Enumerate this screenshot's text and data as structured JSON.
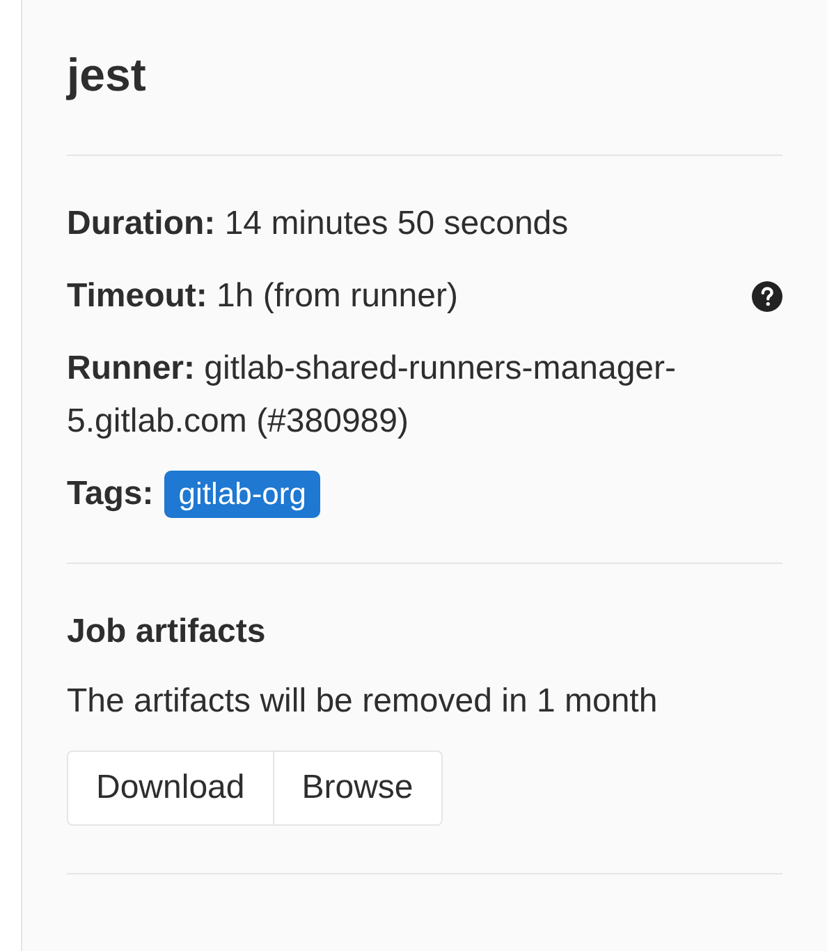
{
  "title": "jest",
  "details": [
    {
      "kind": "text",
      "label": "Duration:",
      "value": "14 minutes 50 seconds",
      "help": false
    },
    {
      "kind": "text",
      "label": "Timeout:",
      "value": "1h (from runner)",
      "help": true
    },
    {
      "kind": "text",
      "label": "Runner:",
      "value": "gitlab-shared-runners-manager-5.gitlab.com (#380989)",
      "help": false
    },
    {
      "kind": "tags",
      "label": "Tags:",
      "tags": [
        "gitlab-org"
      ],
      "help": false
    }
  ],
  "artifacts": {
    "title": "Job artifacts",
    "message": "The artifacts will be removed in 1 month",
    "buttons": [
      "Download",
      "Browse"
    ]
  }
}
